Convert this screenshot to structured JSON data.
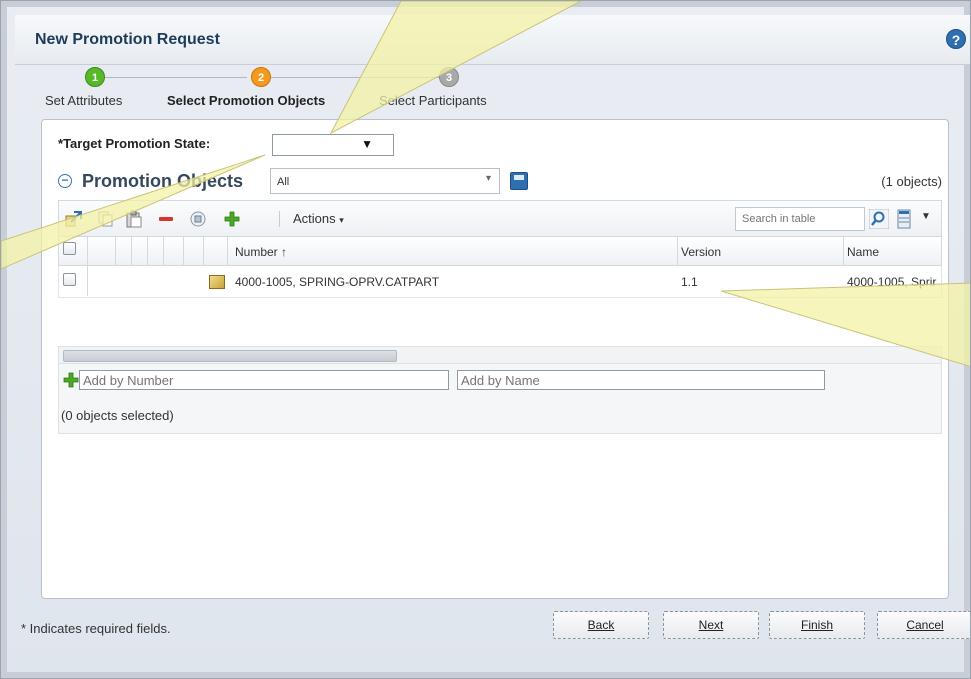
{
  "window": {
    "title": "New Promotion Request",
    "help_icon": "question-icon"
  },
  "steps": [
    {
      "number": "1",
      "label": "Set Attributes",
      "state": "complete",
      "color": "#57b82a"
    },
    {
      "number": "2",
      "label": "Select Promotion Objects",
      "state": "current",
      "color": "#f39a1e"
    },
    {
      "number": "3",
      "label": "Select Participants",
      "state": "pending",
      "color": "#a9a9a9"
    }
  ],
  "form": {
    "target_state_label": "Target Promotion State:",
    "required_marker": "*",
    "target_state_value": ""
  },
  "section": {
    "title": "Promotion Objects",
    "collapse_icon": "minus",
    "view_value": "All",
    "count": "(1 objects)"
  },
  "toolbar": {
    "actions_label": "Actions",
    "search_placeholder": "Search in table",
    "icons": [
      "insert-icon",
      "copy-icon",
      "paste-icon",
      "remove-icon",
      "view-icon",
      "add-icon",
      "search-icon",
      "columns-icon"
    ]
  },
  "table": {
    "columns": [
      "Number",
      "Version",
      "Name"
    ],
    "sort_indicator": "↑",
    "rows": [
      {
        "number": "4000-1005, SPRING-OPRV.CATPART",
        "version": "1.1",
        "name": "4000-1005, Sprir"
      }
    ]
  },
  "add_bar": {
    "by_number_placeholder": "Add by Number",
    "by_name_placeholder": "Add by Name",
    "selected_count": "(0 objects selected)"
  },
  "footer": {
    "required_note": "* Indicates required fields.",
    "back_label": "Back",
    "next_label": "Next",
    "finish_label": "Finish",
    "cancel_label": "Cancel"
  },
  "colors": {
    "accent": "#2f6fb0",
    "remove": "#d9362b",
    "add": "#4aa82a",
    "callout": "#f3f1a6"
  }
}
